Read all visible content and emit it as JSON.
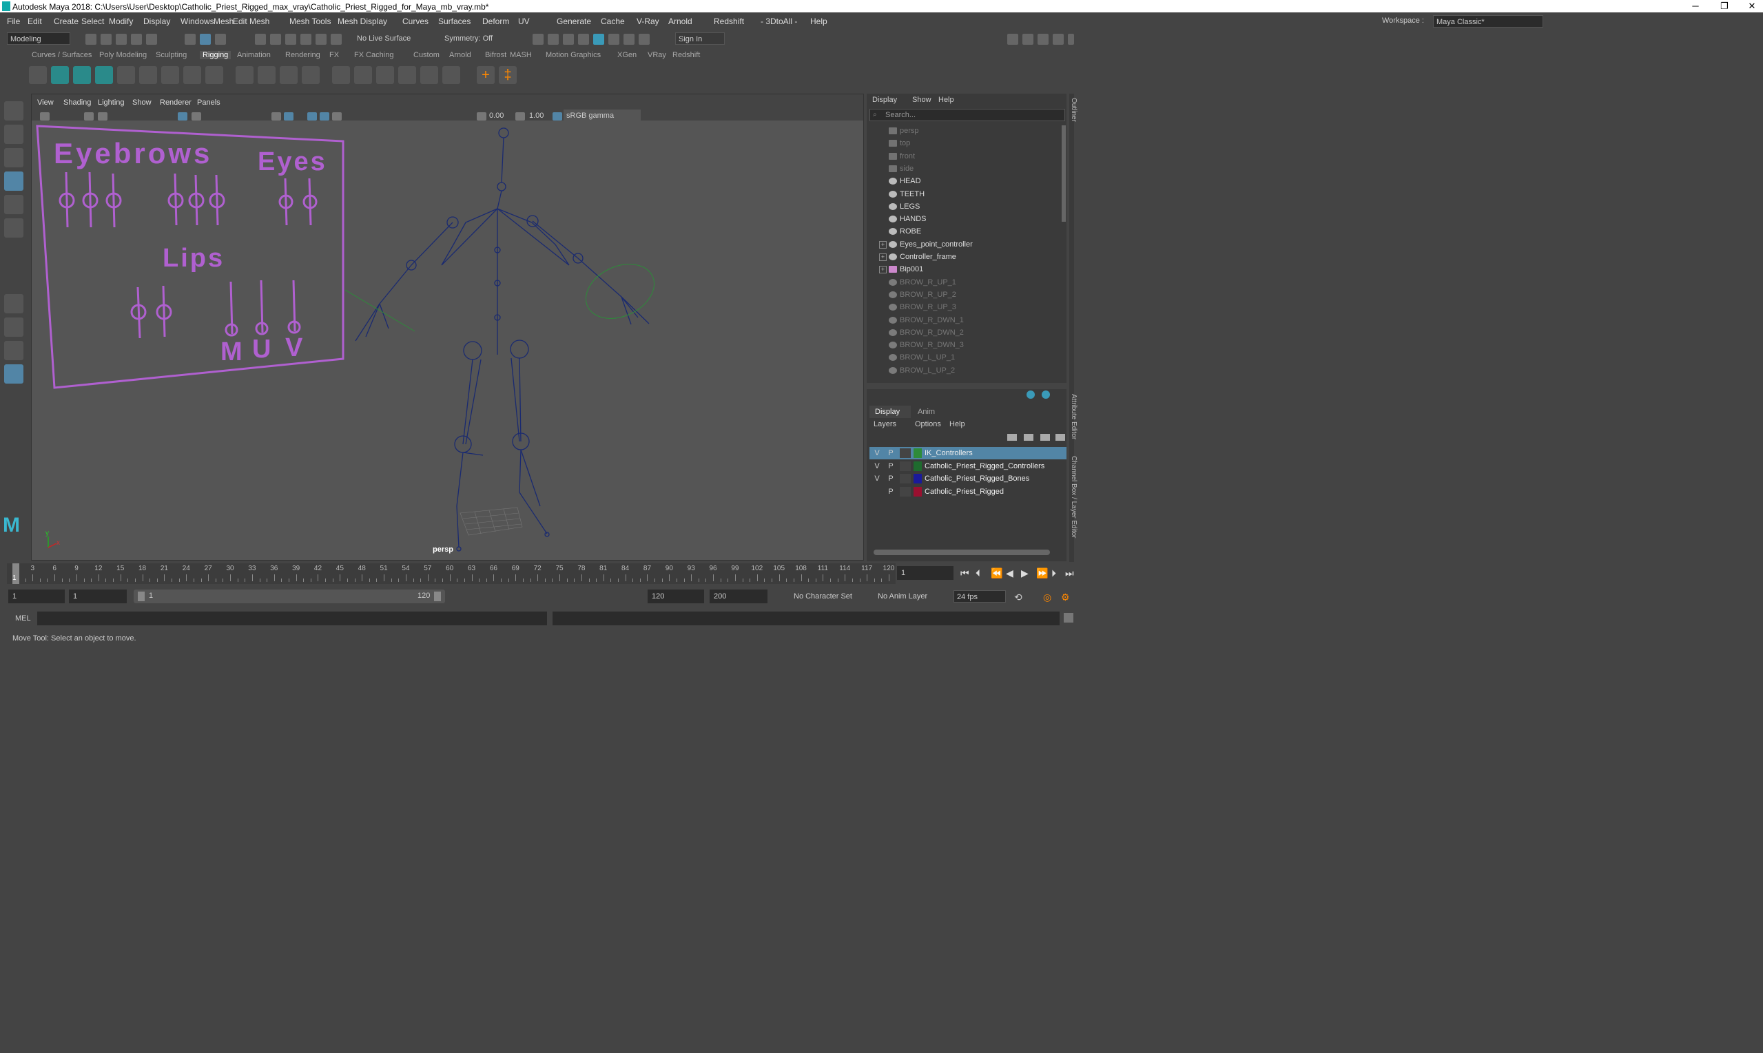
{
  "window": {
    "title": "Autodesk Maya 2018: C:\\Users\\User\\Desktop\\Catholic_Priest_Rigged_max_vray\\Catholic_Priest_Rigged_for_Maya_mb_vray.mb*",
    "min": "─",
    "max": "❐",
    "close": "✕"
  },
  "menubar": [
    "File",
    "Edit",
    "Create",
    "Select",
    "Modify",
    "Display",
    "Windows",
    "Mesh",
    "Edit Mesh",
    "Mesh Tools",
    "Mesh Display",
    "Curves",
    "Surfaces",
    "Deform",
    "UV",
    "Generate",
    "Cache",
    "V-Ray",
    "Arnold",
    "Redshift",
    "- 3DtoAll -",
    "Help"
  ],
  "workspace": {
    "label": "Workspace :",
    "value": "Maya Classic*"
  },
  "statusline": {
    "mode": "Modeling",
    "live_surface": "No Live Surface",
    "symmetry": "Symmetry: Off",
    "sign_in": "Sign In"
  },
  "shelf_tabs": [
    "Curves / Surfaces",
    "Poly Modeling",
    "Sculpting",
    "Rigging",
    "Animation",
    "Rendering",
    "FX",
    "FX Caching",
    "Custom",
    "Arnold",
    "Bifrost",
    "MASH",
    "Motion Graphics",
    "XGen",
    "VRay",
    "Redshift"
  ],
  "active_shelf": "Rigging",
  "viewport": {
    "menus": [
      "View",
      "Shading",
      "Lighting",
      "Show",
      "Renderer",
      "Panels"
    ],
    "exposure": "0.00",
    "gamma": "1.00",
    "color_space": "sRGB gamma",
    "camera_label": "persp",
    "axis_y": "y",
    "axis_x": "x",
    "board": {
      "eyebrows": "Eyebrows",
      "eyes": "Eyes",
      "lips": "Lips",
      "m": "M",
      "u": "U",
      "v": "V"
    }
  },
  "outliner": {
    "menus": [
      "Display",
      "Show",
      "Help"
    ],
    "search_placeholder": "Search...",
    "items": [
      {
        "label": "persp",
        "dim": true,
        "icon": "camera-icon",
        "expand": false
      },
      {
        "label": "top",
        "dim": true,
        "icon": "camera-icon",
        "expand": false
      },
      {
        "label": "front",
        "dim": true,
        "icon": "camera-icon",
        "expand": false
      },
      {
        "label": "side",
        "dim": true,
        "icon": "camera-icon",
        "expand": false
      },
      {
        "label": "HEAD",
        "dim": false,
        "icon": "transform-icon",
        "expand": false
      },
      {
        "label": "TEETH",
        "dim": false,
        "icon": "transform-icon",
        "expand": false
      },
      {
        "label": "LEGS",
        "dim": false,
        "icon": "transform-icon",
        "expand": false
      },
      {
        "label": "HANDS",
        "dim": false,
        "icon": "transform-icon",
        "expand": false
      },
      {
        "label": "ROBE",
        "dim": false,
        "icon": "transform-icon",
        "expand": false
      },
      {
        "label": "Eyes_point_controller",
        "dim": false,
        "icon": "transform-icon",
        "expand": true
      },
      {
        "label": "Controller_frame",
        "dim": false,
        "icon": "transform-icon",
        "expand": true
      },
      {
        "label": "Bip001",
        "dim": false,
        "icon": "joint-icon",
        "expand": true
      },
      {
        "label": "BROW_R_UP_1",
        "dim": true,
        "icon": "transform-icon",
        "expand": false
      },
      {
        "label": "BROW_R_UP_2",
        "dim": true,
        "icon": "transform-icon",
        "expand": false
      },
      {
        "label": "BROW_R_UP_3",
        "dim": true,
        "icon": "transform-icon",
        "expand": false
      },
      {
        "label": "BROW_R_DWN_1",
        "dim": true,
        "icon": "transform-icon",
        "expand": false
      },
      {
        "label": "BROW_R_DWN_2",
        "dim": true,
        "icon": "transform-icon",
        "expand": false
      },
      {
        "label": "BROW_R_DWN_3",
        "dim": true,
        "icon": "transform-icon",
        "expand": false
      },
      {
        "label": "BROW_L_UP_1",
        "dim": true,
        "icon": "transform-icon",
        "expand": false
      },
      {
        "label": "BROW_L_UP_2",
        "dim": true,
        "icon": "transform-icon",
        "expand": false
      }
    ]
  },
  "channel_box": {
    "tabs": [
      "Display",
      "Anim"
    ],
    "menus": [
      "Layers",
      "Options",
      "Help"
    ],
    "layers": [
      {
        "v": "V",
        "p": "P",
        "color": "#2e8b3a",
        "name": "IK_Controllers",
        "selected": true
      },
      {
        "v": "V",
        "p": "P",
        "color": "#1e6b2e",
        "name": "Catholic_Priest_Rigged_Controllers",
        "selected": false
      },
      {
        "v": "V",
        "p": "P",
        "color": "#1a1a9a",
        "name": "Catholic_Priest_Rigged_Bones",
        "selected": false
      },
      {
        "v": "",
        "p": "P",
        "color": "#9a1030",
        "name": "Catholic_Priest_Rigged",
        "selected": false
      }
    ]
  },
  "side_tabs": {
    "outliner": "Outliner",
    "attribute_editor": "Attribute Editor",
    "channel_box": "Channel Box / Layer Editor"
  },
  "timeline": {
    "ticks": [
      "3",
      "6",
      "9",
      "12",
      "15",
      "18",
      "21",
      "24",
      "27",
      "30",
      "33",
      "36",
      "39",
      "42",
      "45",
      "48",
      "51",
      "54",
      "57",
      "60",
      "63",
      "66",
      "69",
      "72",
      "75",
      "78",
      "81",
      "84",
      "87",
      "90",
      "93",
      "96",
      "99",
      "102",
      "105",
      "108",
      "111",
      "114",
      "117",
      "120"
    ],
    "current_frame_marker": "1",
    "current_frame": "1"
  },
  "range": {
    "start": "1",
    "playback_start": "1",
    "slider_start": "1",
    "slider_end": "120",
    "playback_end": "120",
    "end": "200",
    "character_set": "No Character Set",
    "anim_layer": "No Anim Layer",
    "fps": "24 fps"
  },
  "command_line": {
    "label": "MEL"
  },
  "help_line": "Move Tool: Select an object to move.",
  "colors": {
    "accent": "#5285a6",
    "board": "#b060d0",
    "skeleton": "#1a2a70"
  }
}
